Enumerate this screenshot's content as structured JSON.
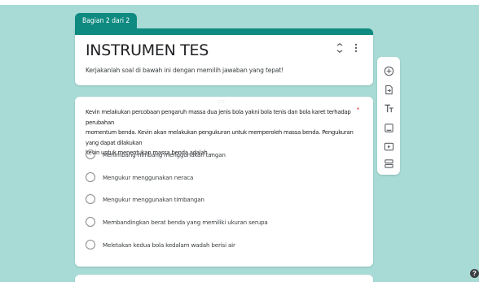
{
  "section": {
    "tag": "Bagian 2 dari 2"
  },
  "header": {
    "title": "INSTRUMEN TES",
    "description": "Kerjakanlah soal di bawah ini dengan memilih jawaban yang tepat!",
    "collapse_icon": "collapse-icon",
    "more_icon": "more-vertical-icon"
  },
  "question": {
    "drag_handle": ":::",
    "text_lines": [
      "Kevin melakukan percobaan pengaruh massa dua jenis bola yakni bola tenis dan bola karet terhadap perubahan",
      "momentum benda. Kevin akan melakukan pengukuran untuk memperoleh massa benda. Pengukuran yang dapat dilakukan",
      "kevin untuk menentukan massa benda adalah ..."
    ],
    "required_mark": "*",
    "options": [
      "Menimbang-nimbang menggunakan tangan",
      "Mengukur menggunakan neraca",
      "Mengukur menggunakan timbangan",
      "Membandingkan berat benda yang memiliki ukuran serupa",
      "Meletakan kedua bola kedalam wadah berisi air"
    ]
  },
  "toolbar": {
    "items": [
      "add-question-icon",
      "import-questions-icon",
      "add-title-icon",
      "add-image-icon",
      "add-video-icon",
      "add-section-icon"
    ]
  },
  "help": {
    "label": "?"
  },
  "colors": {
    "background": "#a8dbd6",
    "accent": "#0e8a80",
    "required": "#d93025"
  }
}
